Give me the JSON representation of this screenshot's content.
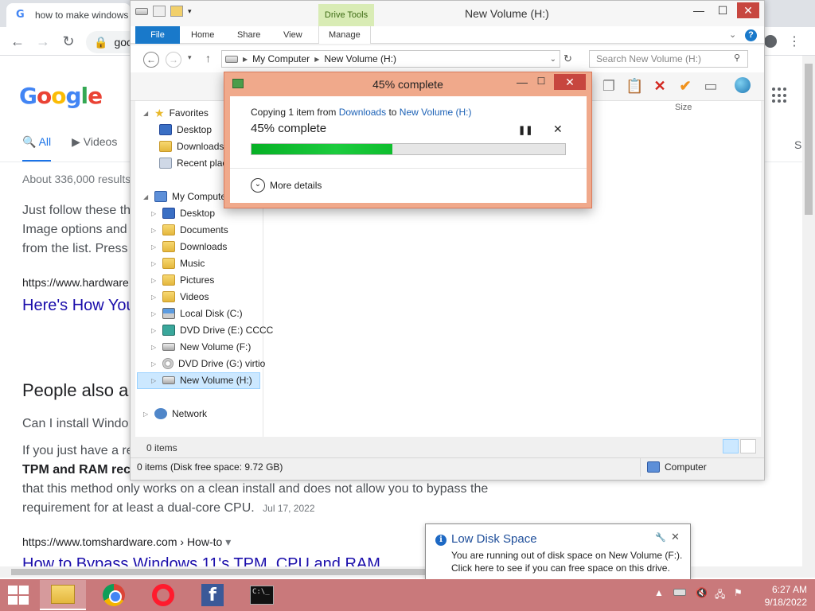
{
  "browser": {
    "tab_title": "how to make windows",
    "omnibox_text": "goo",
    "google_logo": "Google",
    "search_tabs": [
      {
        "label": "All"
      },
      {
        "label": "Videos"
      }
    ],
    "right_tab_label": "S",
    "results_count": "About 336,000 results",
    "snippet_lines": [
      "Just follow these th",
      "Image options and",
      "from the list. Press"
    ],
    "url1": "https://www.hardware",
    "link1": "Here's How You",
    "people_also": "People also a",
    "question1": "Can I install Windo",
    "para_line1": "If you just have a re",
    "para_bold": "TPM and RAM rec",
    "para_line3": "that this method only works on a clean install and does not allow you to bypass the",
    "para_line4": "requirement for at least a dual-core CPU.",
    "para_date": "Jul 17, 2022",
    "url2": "https://www.tomshardware.com › How-to",
    "link2": "How to Bypass Windows 11's TPM, CPU and RAM"
  },
  "explorer": {
    "title": "New Volume (H:)",
    "drive_tools": "Drive Tools",
    "tabs": {
      "file": "File",
      "home": "Home",
      "share": "Share",
      "view": "View",
      "manage": "Manage"
    },
    "address": {
      "root": "My Computer",
      "current": "New Volume (H:)"
    },
    "search_placeholder": "Search New Volume (H:)",
    "columns": {
      "type": "pe",
      "size": "Size"
    },
    "tree": {
      "favorites": "Favorites",
      "fav_desktop": "Desktop",
      "fav_downloads": "Downloads",
      "fav_recent": "Recent plac",
      "computer": "My Compute",
      "desktop": "Desktop",
      "documents": "Documents",
      "downloads": "Downloads",
      "music": "Music",
      "pictures": "Pictures",
      "videos": "Videos",
      "local_disk": "Local Disk (C:)",
      "dvd_e": "DVD Drive (E:) CCCC",
      "vol_f": "New Volume (F:)",
      "dvd_g": "DVD Drive (G:) virtio",
      "vol_h": "New Volume (H:)",
      "network": "Network"
    },
    "items_count": "0 items",
    "status_left": "0 items (Disk free space: 9.72 GB)",
    "status_right": "Computer"
  },
  "copy_dialog": {
    "title": "45% complete",
    "line_prefix": "Copying 1 item from",
    "source": "Downloads",
    "to": "to",
    "destination": "New Volume (H:)",
    "percent_label": "45% complete",
    "progress_fraction": 0.45,
    "more_details": "More details"
  },
  "notification": {
    "title": "Low Disk Space",
    "line1": "You are running out of disk space on New Volume (F:).",
    "line2": "Click here to see if you can free space on this drive."
  },
  "taskbar": {
    "time": "6:27 AM",
    "date": "9/18/2022",
    "apps": [
      "file-explorer",
      "chrome",
      "opera",
      "facebook",
      "command-prompt"
    ]
  },
  "colors": {
    "taskbar": "#c9797b",
    "dialog_frame": "#f0a98b",
    "progress_green": "#06b025",
    "link_blue": "#1a0dab",
    "drive_tools": "#d9ecb5"
  }
}
